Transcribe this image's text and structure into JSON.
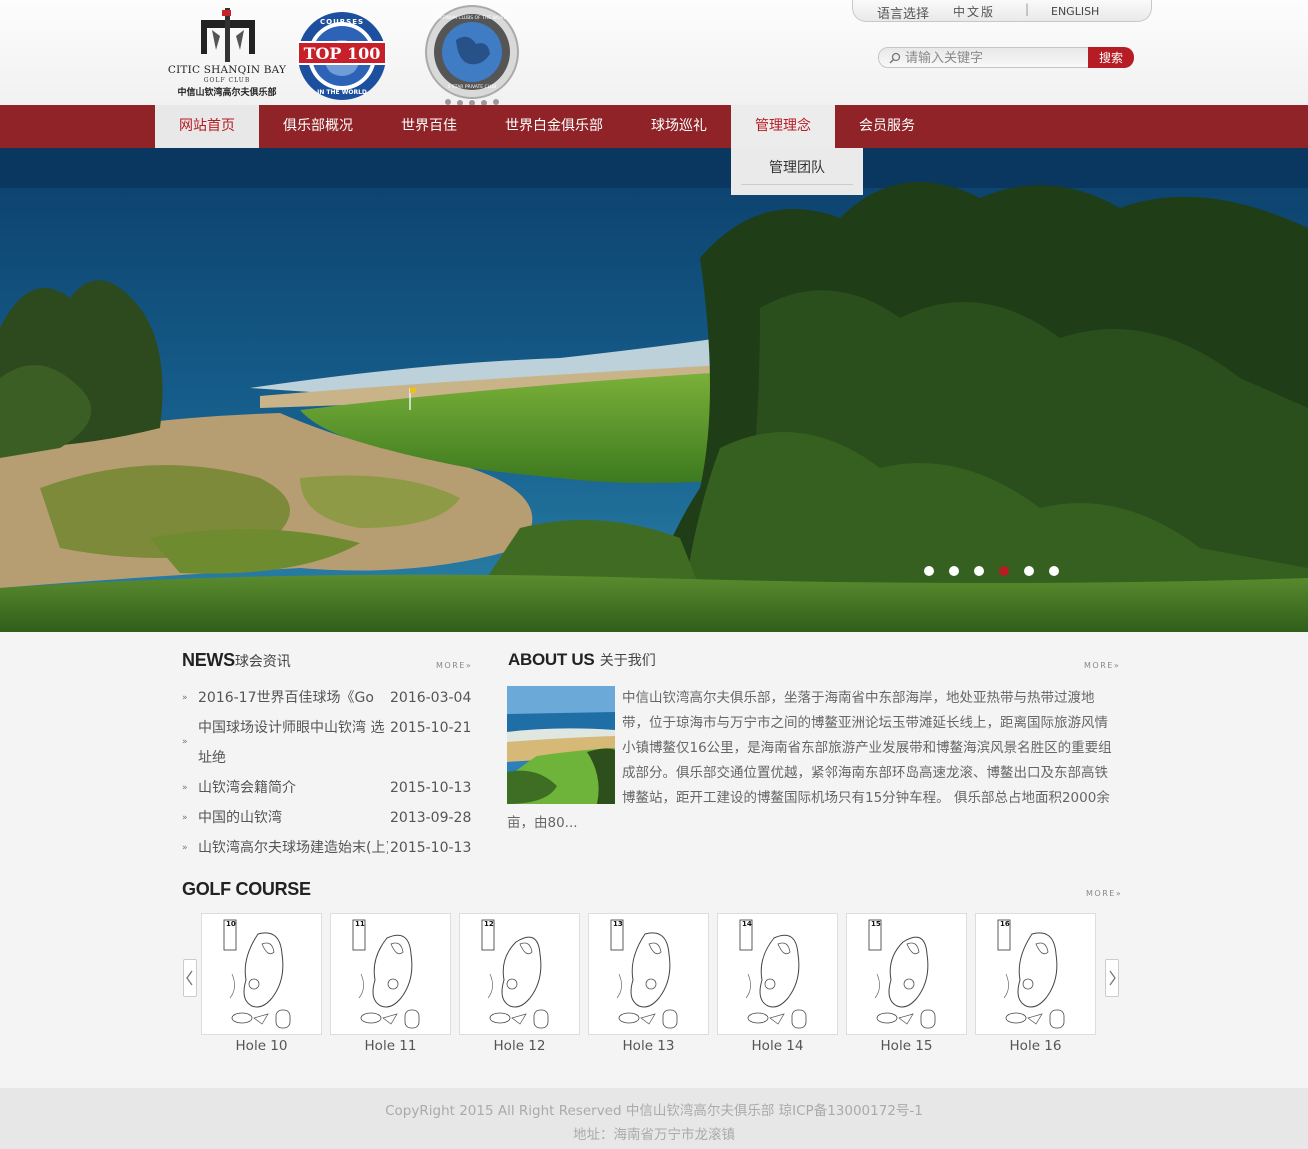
{
  "header": {
    "logo": {
      "line1": "CITIC SHANQIN BAY",
      "line2": "GOLF CLUB",
      "line3": "中信山钦湾高尔夫俱乐部"
    },
    "badge_top100": {
      "ring_text": "COURSES",
      "ring_bottom": "IN THE WORLD",
      "center_text": "TOP 100"
    },
    "badge_platinum": {
      "ring_text": "PLATINUM CLUBS OF THE WORLD",
      "ring_bottom": "5 STAR PRIVATE CLUB"
    },
    "language": {
      "label": "语言选择",
      "chinese": "中文版",
      "separator": "|",
      "english": "ENGLISH"
    },
    "search": {
      "placeholder": "请输入关键字",
      "button": "搜索"
    }
  },
  "nav": {
    "items": [
      {
        "label": "网站首页"
      },
      {
        "label": "俱乐部概况"
      },
      {
        "label": "世界百佳"
      },
      {
        "label": "世界白金俱乐部"
      },
      {
        "label": "球场巡礼"
      },
      {
        "label": "管理理念"
      },
      {
        "label": "会员服务"
      }
    ],
    "submenu": {
      "label": "管理团队"
    }
  },
  "slider": {
    "dot_count": 6,
    "active_index": 3
  },
  "news": {
    "title_en": "NEWS",
    "title_cn": "球会资讯",
    "more": "MORE»",
    "items": [
      {
        "title": "2016-17世界百佳球场《Go",
        "date": "2016-03-04"
      },
      {
        "title": "中国球场设计师眼中山钦湾 选址绝",
        "date": "2015-10-21"
      },
      {
        "title": "山钦湾会籍简介",
        "date": "2015-10-13"
      },
      {
        "title": "中国的山钦湾",
        "date": "2013-09-28"
      },
      {
        "title": "山钦湾高尔夫球场建造始末(上)",
        "date": "2015-10-13"
      }
    ]
  },
  "about": {
    "title_en": "ABOUT US",
    "title_cn": "关于我们",
    "more": "MORE»",
    "text": "中信山钦湾高尔夫俱乐部，坐落于海南省中东部海岸，地处亚热带与热带过渡地带，位于琼海市与万宁市之间的博鳌亚洲论坛玉带滩延长线上，距离国际旅游风情小镇博鳌仅16公里，是海南省东部旅游产业发展带和博鳌海滨风景名胜区的重要组成部分。俱乐部交通位置优越，紧邻海南东部环岛高速龙滚、博鳌出口及东部高铁博鳌站，距开工建设的博鳌国际机场只有15分钟车程。 俱乐部总占地面积2000余亩，由80..."
  },
  "golf_course": {
    "title_en": "GOLF COURSE",
    "more": "MORE»",
    "holes": [
      {
        "label": "Hole 10",
        "number": "10"
      },
      {
        "label": "Hole 11",
        "number": "11"
      },
      {
        "label": "Hole 12",
        "number": "12"
      },
      {
        "label": "Hole 13",
        "number": "13"
      },
      {
        "label": "Hole 14",
        "number": "14"
      },
      {
        "label": "Hole 15",
        "number": "15"
      },
      {
        "label": "Hole 16",
        "number": "16"
      }
    ]
  },
  "footer": {
    "copyright": "CopyRight 2015 All Right Reserved 中信山钦湾高尔夫俱乐部 琼ICP备13000172号-1",
    "address": "地址：海南省万宁市龙滚镇"
  },
  "colors": {
    "brand_red": "#8f2327",
    "accent_red": "#b51c24"
  }
}
